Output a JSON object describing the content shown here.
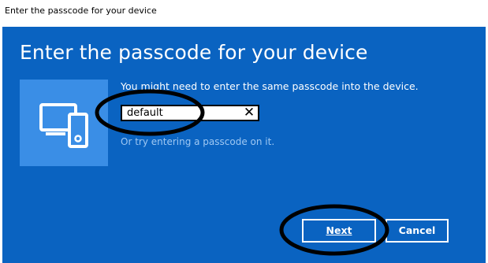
{
  "window": {
    "title": "Enter the passcode for your device"
  },
  "dialog": {
    "heading": "Enter the passcode for your device",
    "instruction": "You might need to enter the same passcode into the device.",
    "passcode_value": "default",
    "clear_symbol": "✕",
    "alt_text": "Or try entering a passcode on it.",
    "device_icon": "tablet-and-phone-icon"
  },
  "buttons": {
    "next_label": "Next",
    "cancel_label": "Cancel"
  },
  "colors": {
    "panel_background": "#0a63c1",
    "tile_background": "#3a8ee6",
    "alt_text": "#9fc8f3"
  }
}
